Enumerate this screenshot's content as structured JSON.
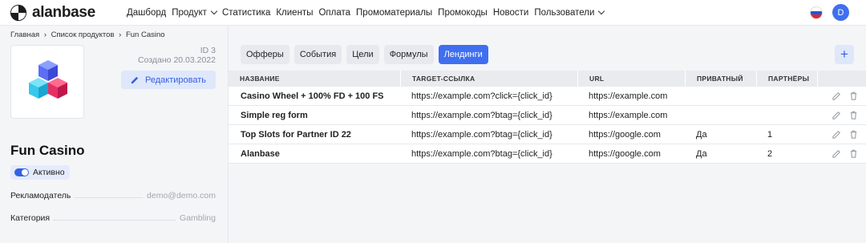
{
  "brand": {
    "name": "alanbase"
  },
  "nav": {
    "items": [
      {
        "label": "Дашборд"
      },
      {
        "label": "Продукт",
        "dropdown": true
      },
      {
        "label": "Статистика"
      },
      {
        "label": "Клиенты"
      },
      {
        "label": "Оплата"
      },
      {
        "label": "Промоматериалы"
      },
      {
        "label": "Промокоды"
      },
      {
        "label": "Новости"
      },
      {
        "label": "Пользователи",
        "dropdown": true
      }
    ],
    "avatar_letter": "D",
    "language_flag": "ru-flag-icon"
  },
  "breadcrumb": [
    "Главная",
    "›",
    "Список продуктов",
    "›",
    "Fun Casino"
  ],
  "product": {
    "id_text": "ID 3",
    "created_text": "Создано 20.03.2022",
    "edit_label": "Редактировать",
    "title": "Fun Casino",
    "status_label": "Активно",
    "status_active": true,
    "fields": [
      {
        "key": "Рекламодатель",
        "value": "demo@demo.com"
      },
      {
        "key": "Категория",
        "value": "Gambling"
      }
    ]
  },
  "tabs": [
    {
      "label": "Офферы",
      "active": false
    },
    {
      "label": "События",
      "active": false
    },
    {
      "label": "Цели",
      "active": false
    },
    {
      "label": "Формулы",
      "active": false
    },
    {
      "label": "Лендинги",
      "active": true
    }
  ],
  "add_button": "+",
  "table": {
    "columns": [
      "НАЗВАНИЕ",
      "TARGET-ССЫЛКА",
      "URL",
      "ПРИВАТНЫЙ",
      "ПАРТНЁРЫ"
    ],
    "rows": [
      {
        "name": "Casino Wheel + 100% FD + 100 FS",
        "target": "https://example.com?click={click_id}",
        "url": "https://example.com",
        "private": "",
        "partners": ""
      },
      {
        "name": "Simple reg form",
        "target": "https://example.com?btag={click_id}",
        "url": "https://example.com",
        "private": "",
        "partners": ""
      },
      {
        "name": "Top Slots for Partner ID 22",
        "target": "https://example.com?btag={click_id}",
        "url": "https://google.com",
        "private": "Да",
        "partners": "1"
      },
      {
        "name": "Alanbase",
        "target": "https://example.com?btag={click_id}",
        "url": "https://google.com",
        "private": "Да",
        "partners": "2"
      }
    ]
  },
  "colors": {
    "accent": "#3f6ff0",
    "accent_light": "#dfe7fb"
  }
}
